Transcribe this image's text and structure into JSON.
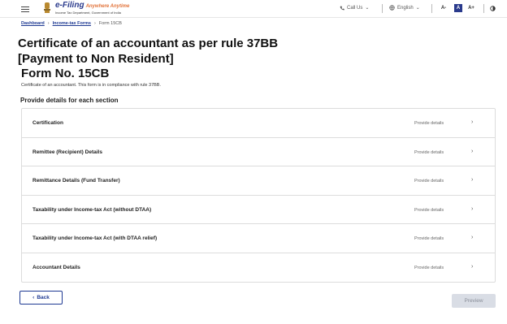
{
  "header": {
    "brand_main": "e-Filing",
    "brand_tag": "Anywhere Anytime",
    "brand_sub": "Income Tax Department, Government of India",
    "call_us": "Call Us",
    "language": "English",
    "font_decrease": "A-",
    "font_normal": "A",
    "font_increase": "A+"
  },
  "breadcrumb": {
    "items": [
      "Dashboard",
      "Income-tax Forms",
      "Form 15CB"
    ]
  },
  "page": {
    "title_line1": "Certificate of an accountant as per rule 37BB",
    "title_line2": "[Payment to Non Resident]",
    "form_no": "Form No. 15CB",
    "description": "Certificate of an accountant. This form is in compliance with rule 37BB.",
    "section_heading": "Provide details for each section"
  },
  "sections": [
    {
      "label": "Certification",
      "action": "Provide details"
    },
    {
      "label": "Remittee (Recipient) Details",
      "action": "Provide details"
    },
    {
      "label": "Remittance Details (Fund Transfer)",
      "action": "Provide details"
    },
    {
      "label": "Taxability under Income-tax Act (without DTAA)",
      "action": "Provide details"
    },
    {
      "label": "Taxability under Income-tax Act (with DTAA relief)",
      "action": "Provide details"
    },
    {
      "label": "Accountant Details",
      "action": "Provide details"
    }
  ],
  "buttons": {
    "back": "Back",
    "preview": "Preview"
  },
  "colors": {
    "brand_blue": "#2a3a8c",
    "link_blue": "#1f3a93",
    "accent_orange": "#e2733a",
    "disabled_bg": "#d9dde5"
  }
}
